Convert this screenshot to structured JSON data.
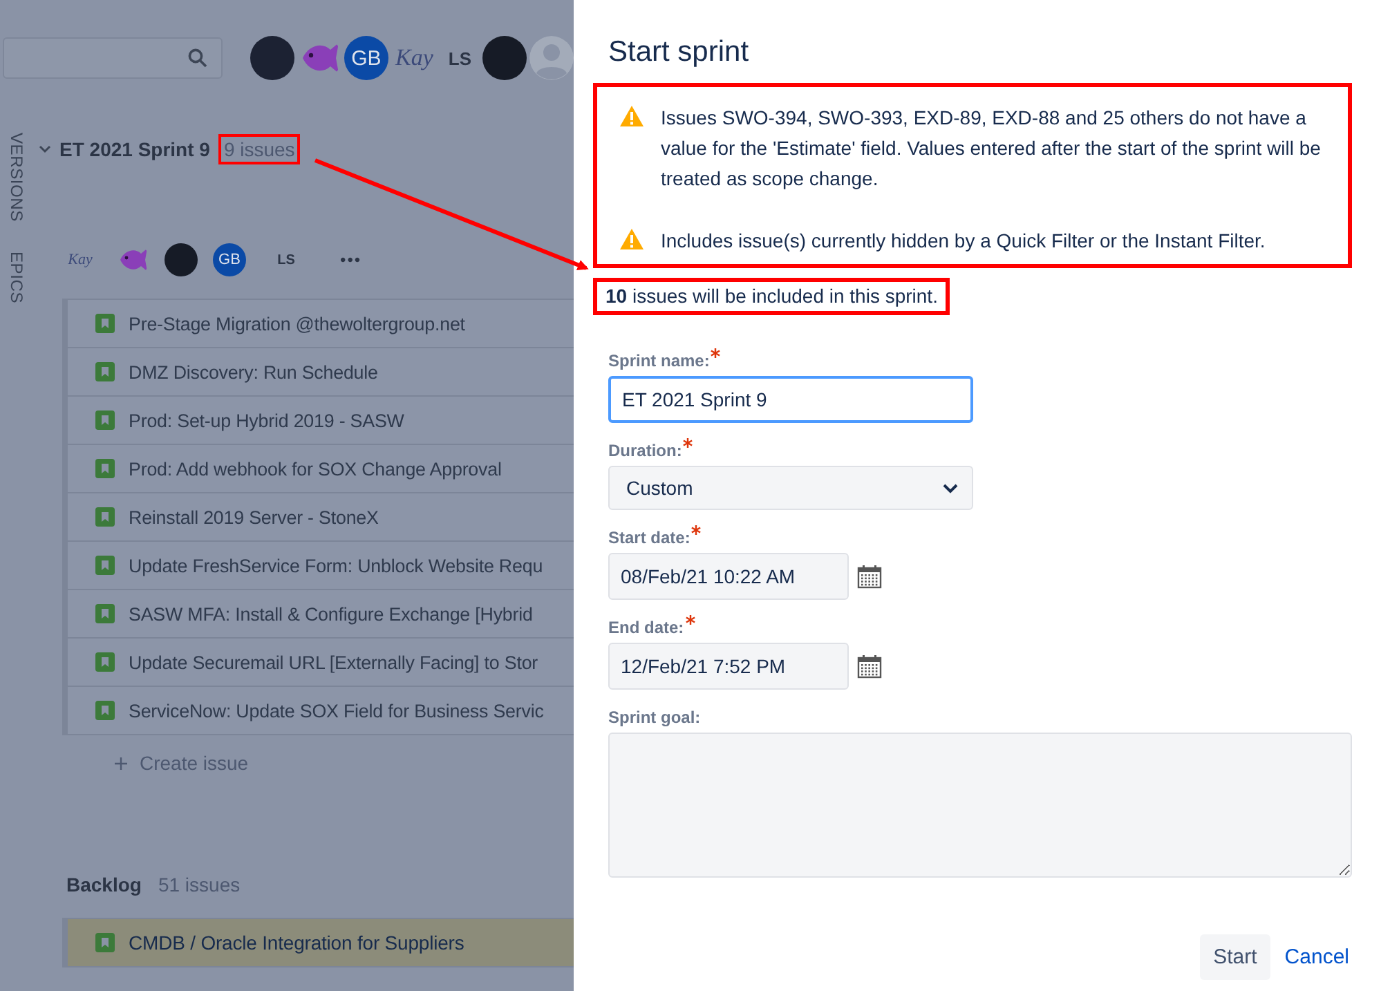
{
  "board": {
    "avatars": [
      {
        "kind": "photo"
      },
      {
        "kind": "fish"
      },
      {
        "kind": "initials",
        "text": "GB"
      },
      {
        "kind": "signature",
        "text": "Kay"
      },
      {
        "kind": "plain",
        "text": "LS"
      },
      {
        "kind": "logo"
      },
      {
        "kind": "default"
      }
    ],
    "side_tabs": [
      "VERSIONS",
      "EPICS"
    ],
    "sprint": {
      "name": "ET 2021 Sprint 9",
      "count": "9 issues",
      "count_highlighted": true,
      "expanded": true,
      "assignees": [
        {
          "kind": "signature",
          "text": "Kay"
        },
        {
          "kind": "fish"
        },
        {
          "kind": "logo"
        },
        {
          "kind": "initials",
          "text": "GB"
        },
        {
          "kind": "plain",
          "text": "LS"
        }
      ],
      "more": "•••",
      "issues": [
        {
          "summary": "Pre-Stage Migration @thewoltergroup.net",
          "selected": false
        },
        {
          "summary": "DMZ Discovery: Run Schedule",
          "selected": false
        },
        {
          "summary": "Prod: Set-up Hybrid 2019 - SASW",
          "selected": false
        },
        {
          "summary": "Prod: Add webhook for SOX Change Approval",
          "selected": false
        },
        {
          "summary": "Reinstall 2019 Server - StoneX",
          "selected": false
        },
        {
          "summary": "Update FreshService Form: Unblock Website Requ",
          "selected": false
        },
        {
          "summary": "SASW MFA: Install & Configure Exchange [Hybrid",
          "selected": false
        },
        {
          "summary": "Update Securemail URL [Externally Facing] to Stor",
          "selected": false
        },
        {
          "summary": "ServiceNow: Update SOX Field for Business Servic",
          "selected": false
        }
      ],
      "create_issue": "Create issue"
    },
    "backlog": {
      "name": "Backlog",
      "count": "51 issues",
      "issues": [
        {
          "summary": "CMDB / Oracle Integration for Suppliers",
          "selected": true
        }
      ]
    }
  },
  "dialog": {
    "title": "Start sprint",
    "warnings_highlighted": true,
    "warnings": [
      "Issues SWO-394, SWO-393, EXD-89, EXD-88 and 25 others do not have a value for the 'Estimate' field. Values entered after the start of the sprint will be treated as scope change.",
      "Includes issue(s) currently hidden by a Quick Filter or the Instant Filter."
    ],
    "included": "**10** issues will be included in this sprint.",
    "included_highlighted": true,
    "fields": [
      {
        "kind": "text",
        "label": "Sprint name:",
        "required": true,
        "value": "ET 2021 Sprint 9",
        "focused": true
      },
      {
        "kind": "select",
        "label": "Duration:",
        "required": true,
        "value": "Custom"
      },
      {
        "kind": "date",
        "label": "Start date:",
        "required": true,
        "value": "08/Feb/21 10:22 AM"
      },
      {
        "kind": "date",
        "label": "End date:",
        "required": true,
        "value": "12/Feb/21 7:52 PM"
      },
      {
        "kind": "textarea",
        "label": "Sprint goal:",
        "required": false
      }
    ],
    "buttons": [
      {
        "kind": "primary",
        "label": "Start"
      },
      {
        "kind": "link",
        "label": "Cancel"
      }
    ]
  }
}
